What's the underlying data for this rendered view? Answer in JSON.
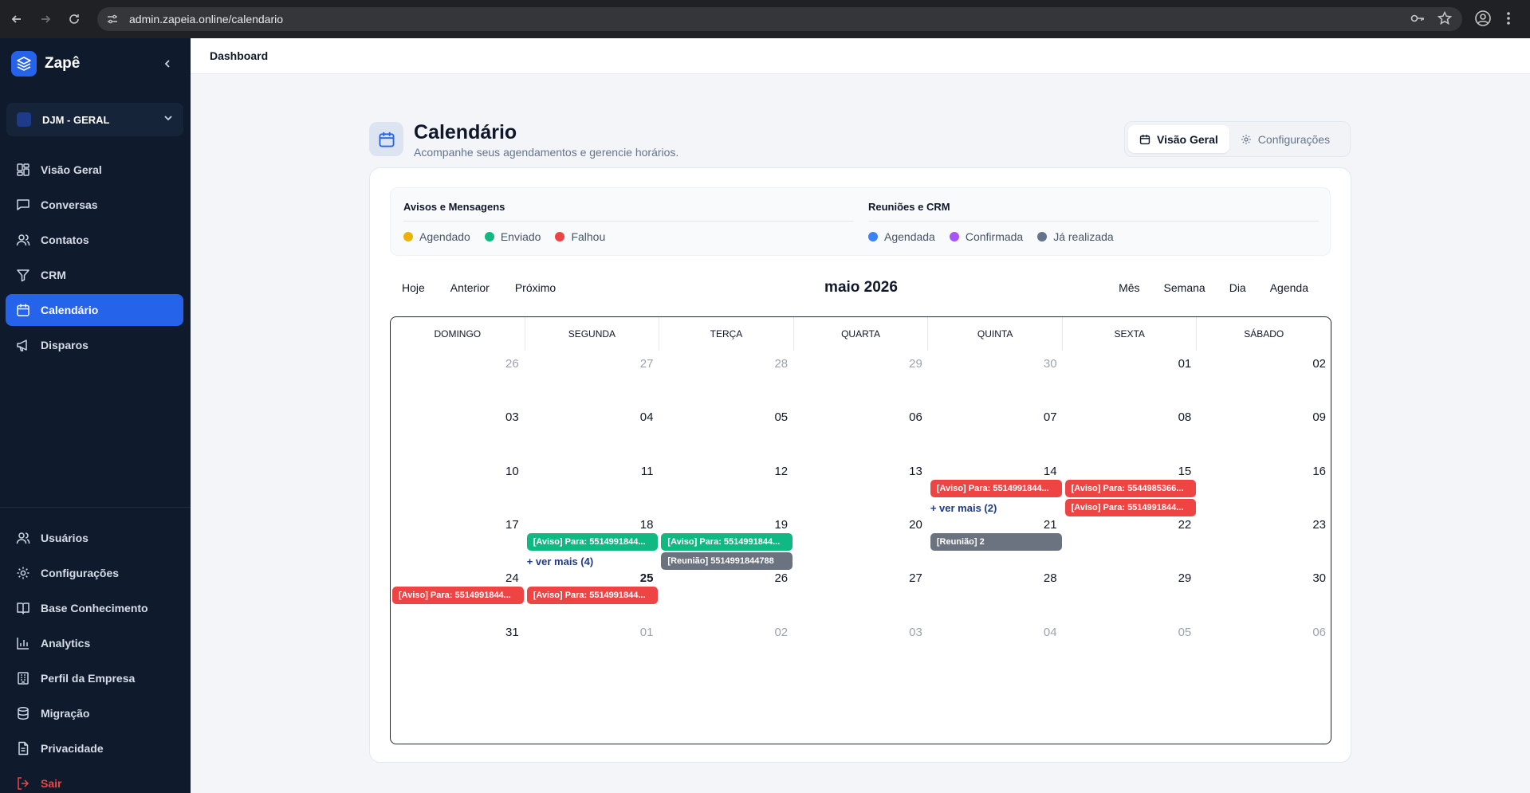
{
  "browser": {
    "url": "admin.zapeia.online/calendario"
  },
  "sidebar": {
    "brand": "Zapê",
    "workspace": "DJM - GERAL",
    "items_top": [
      {
        "label": "Visão Geral",
        "icon": "layout-grid-icon"
      },
      {
        "label": "Conversas",
        "icon": "message-square-icon"
      },
      {
        "label": "Contatos",
        "icon": "users-icon"
      },
      {
        "label": "CRM",
        "icon": "filter-icon"
      },
      {
        "label": "Calendário",
        "icon": "calendar-icon",
        "active": true
      },
      {
        "label": "Disparos",
        "icon": "megaphone-icon"
      }
    ],
    "items_bottom": [
      {
        "label": "Usuários",
        "icon": "users-icon"
      },
      {
        "label": "Configurações",
        "icon": "gear-icon"
      },
      {
        "label": "Base Conhecimento",
        "icon": "book-icon"
      },
      {
        "label": "Analytics",
        "icon": "bar-chart-icon"
      },
      {
        "label": "Perfil da Empresa",
        "icon": "building-icon"
      },
      {
        "label": "Migração",
        "icon": "database-icon"
      },
      {
        "label": "Privacidade",
        "icon": "file-text-icon"
      },
      {
        "label": "Sair",
        "icon": "logout-icon"
      }
    ]
  },
  "topbar": {
    "breadcrumb": "Dashboard"
  },
  "header": {
    "title": "Calendário",
    "subtitle": "Acompanhe seus agendamentos e gerencie horários.",
    "tabs": [
      {
        "label": "Visão Geral",
        "active": true
      },
      {
        "label": "Configurações",
        "active": false
      }
    ]
  },
  "legend": {
    "groups": [
      {
        "title": "Avisos e Mensagens",
        "items": [
          {
            "label": "Agendado",
            "color": "#eab308"
          },
          {
            "label": "Enviado",
            "color": "#10b981"
          },
          {
            "label": "Falhou",
            "color": "#ef4444"
          }
        ]
      },
      {
        "title": "Reuniões e CRM",
        "items": [
          {
            "label": "Agendada",
            "color": "#3b82f6"
          },
          {
            "label": "Confirmada",
            "color": "#a855f7"
          },
          {
            "label": "Já realizada",
            "color": "#64748b"
          }
        ]
      }
    ]
  },
  "toolbar": {
    "today": "Hoje",
    "prev": "Anterior",
    "next": "Próximo",
    "month_label": "maio 2026",
    "views": [
      "Mês",
      "Semana",
      "Dia",
      "Agenda"
    ]
  },
  "calendar": {
    "weekdays": [
      "DOMINGO",
      "SEGUNDA",
      "TERÇA",
      "QUARTA",
      "QUINTA",
      "SEXTA",
      "SÁBADO"
    ],
    "weeks": [
      [
        {
          "d": "26",
          "o": true
        },
        {
          "d": "27",
          "o": true
        },
        {
          "d": "28",
          "o": true
        },
        {
          "d": "29",
          "o": true
        },
        {
          "d": "30",
          "o": true
        },
        {
          "d": "01"
        },
        {
          "d": "02"
        }
      ],
      [
        {
          "d": "03"
        },
        {
          "d": "04"
        },
        {
          "d": "05"
        },
        {
          "d": "06"
        },
        {
          "d": "07"
        },
        {
          "d": "08"
        },
        {
          "d": "09"
        }
      ],
      [
        {
          "d": "10"
        },
        {
          "d": "11"
        },
        {
          "d": "12"
        },
        {
          "d": "13"
        },
        {
          "d": "14"
        },
        {
          "d": "15"
        },
        {
          "d": "16"
        }
      ],
      [
        {
          "d": "17"
        },
        {
          "d": "18"
        },
        {
          "d": "19"
        },
        {
          "d": "20"
        },
        {
          "d": "21"
        },
        {
          "d": "22"
        },
        {
          "d": "23"
        }
      ],
      [
        {
          "d": "24"
        },
        {
          "d": "25",
          "today": true
        },
        {
          "d": "26"
        },
        {
          "d": "27"
        },
        {
          "d": "28"
        },
        {
          "d": "29"
        },
        {
          "d": "30"
        }
      ],
      [
        {
          "d": "31"
        },
        {
          "d": "01",
          "o": true
        },
        {
          "d": "02",
          "o": true
        },
        {
          "d": "03",
          "o": true
        },
        {
          "d": "04",
          "o": true
        },
        {
          "d": "05",
          "o": true
        },
        {
          "d": "06",
          "o": true
        }
      ]
    ],
    "events": [
      {
        "week": 2,
        "day": 4,
        "row": 0,
        "text": "[Aviso] Para: 5514991844...",
        "color": "#ef4444"
      },
      {
        "week": 2,
        "day": 5,
        "row": 0,
        "text": "[Aviso] Para: 5544985366...",
        "color": "#ef4444"
      },
      {
        "week": 2,
        "day": 5,
        "row": 1,
        "text": "[Aviso] Para: 5514991844...",
        "color": "#ef4444"
      },
      {
        "week": 3,
        "day": 1,
        "row": 0,
        "text": "[Aviso] Para: 5514991844...",
        "color": "#10b981"
      },
      {
        "week": 3,
        "day": 2,
        "row": 0,
        "text": "[Aviso] Para: 5514991844...",
        "color": "#10b981"
      },
      {
        "week": 3,
        "day": 2,
        "row": 1,
        "text": "[Reunião] 5514991844788",
        "color": "#6b7280"
      },
      {
        "week": 3,
        "day": 4,
        "row": 0,
        "text": "[Reunião] 2",
        "color": "#6b7280"
      },
      {
        "week": 4,
        "day": 0,
        "row": 0,
        "text": "[Aviso] Para: 5514991844...",
        "color": "#ef4444"
      },
      {
        "week": 4,
        "day": 1,
        "row": 0,
        "text": "[Aviso] Para: 5514991844...",
        "color": "#ef4444"
      }
    ],
    "more_links": [
      {
        "week": 2,
        "day": 4,
        "row": 1,
        "text": "+ ver mais (2)"
      },
      {
        "week": 3,
        "day": 1,
        "row": 1,
        "text": "+ ver mais (4)"
      }
    ]
  }
}
